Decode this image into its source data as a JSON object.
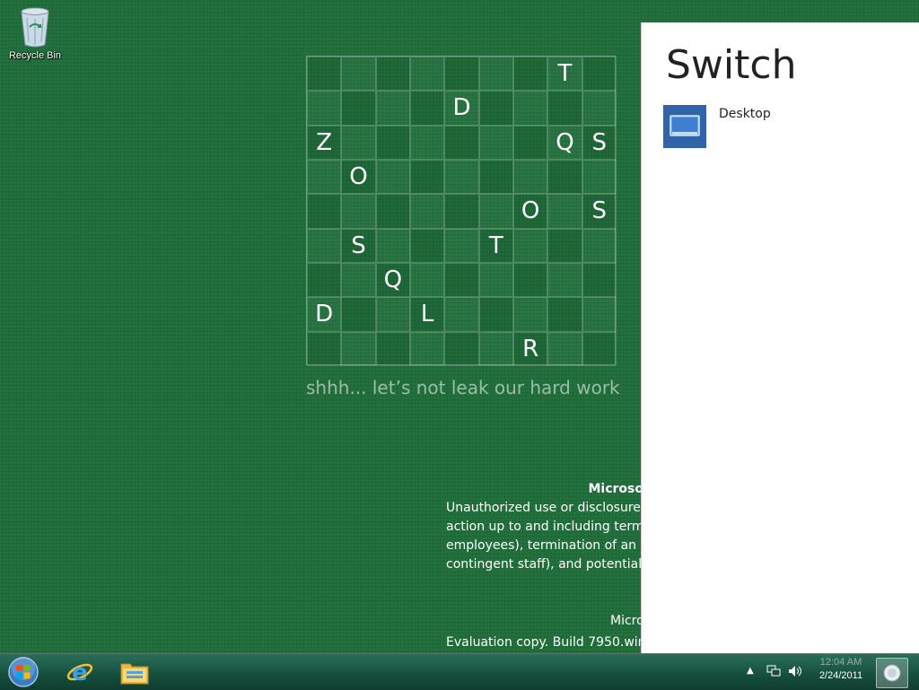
{
  "desktop": {
    "icons": [
      {
        "label": "Recycle Bin",
        "icon": "recycle-bin-icon"
      }
    ]
  },
  "grid": {
    "rows": [
      [
        "",
        "",
        "",
        "",
        "",
        "",
        "",
        "T",
        ""
      ],
      [
        "",
        "",
        "",
        "",
        "D",
        "",
        "",
        "",
        ""
      ],
      [
        "Z",
        "",
        "",
        "",
        "",
        "",
        "",
        "Q",
        "S"
      ],
      [
        "",
        "O",
        "",
        "",
        "",
        "",
        "",
        "",
        ""
      ],
      [
        "",
        "",
        "",
        "",
        "",
        "",
        "O",
        "",
        "S"
      ],
      [
        "",
        "S",
        "",
        "",
        "",
        "T",
        "",
        "",
        ""
      ],
      [
        "",
        "",
        "Q",
        "",
        "",
        "",
        "",
        "",
        ""
      ],
      [
        "D",
        "",
        "",
        "L",
        "",
        "",
        "",
        "",
        ""
      ],
      [
        "",
        "",
        "",
        "",
        "",
        "",
        "R",
        "",
        ""
      ]
    ],
    "tagline": "shhh... let’s not leak our hard work"
  },
  "legal": {
    "title": "Microso",
    "lines": [
      "Unauthorized use or disclosure",
      "action up to and including termi",
      "employees), termination of an a",
      "contingent staff), and potential"
    ],
    "company": "Micro",
    "evaluation": "Evaluation copy. Build 7950.winm"
  },
  "switch_pane": {
    "title": "Switch",
    "items": [
      {
        "label": "Desktop",
        "icon": "desktop-icon"
      }
    ]
  },
  "taskbar": {
    "start": "windows-start-icon",
    "buttons": [
      "internet-explorer-icon",
      "file-explorer-icon"
    ],
    "tray": {
      "clock_time": "12:04 AM",
      "date": "2/24/2011"
    }
  },
  "colors": {
    "desktop_bg": "#1d6b37",
    "switch_bg": "#ffffff",
    "tile_blue": "#2f64a8"
  }
}
